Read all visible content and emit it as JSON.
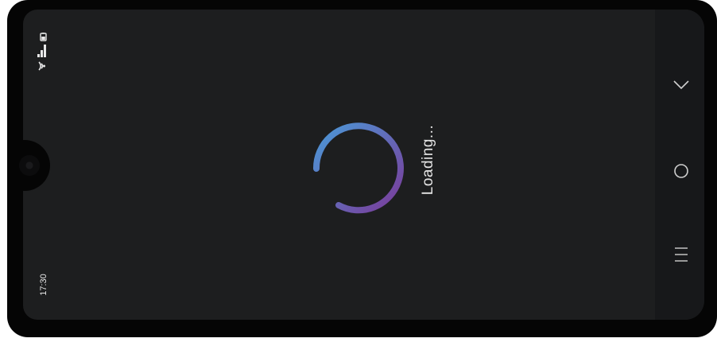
{
  "status_bar": {
    "time": "17:30",
    "icons": [
      "wifi-icon",
      "signal-icon",
      "battery-icon"
    ]
  },
  "main": {
    "loading_text": "Loading...",
    "spinner_gradient": [
      "#4a9ad8",
      "#7b3a99"
    ]
  },
  "nav_bar": {
    "buttons": [
      "chevron-down-icon",
      "circle-home-icon",
      "menu-lines-icon"
    ]
  },
  "colors": {
    "screen_background": "#1d1e1f",
    "navbar_background": "#17181a",
    "bezel": "#050505",
    "text": "#e4e4e4"
  }
}
